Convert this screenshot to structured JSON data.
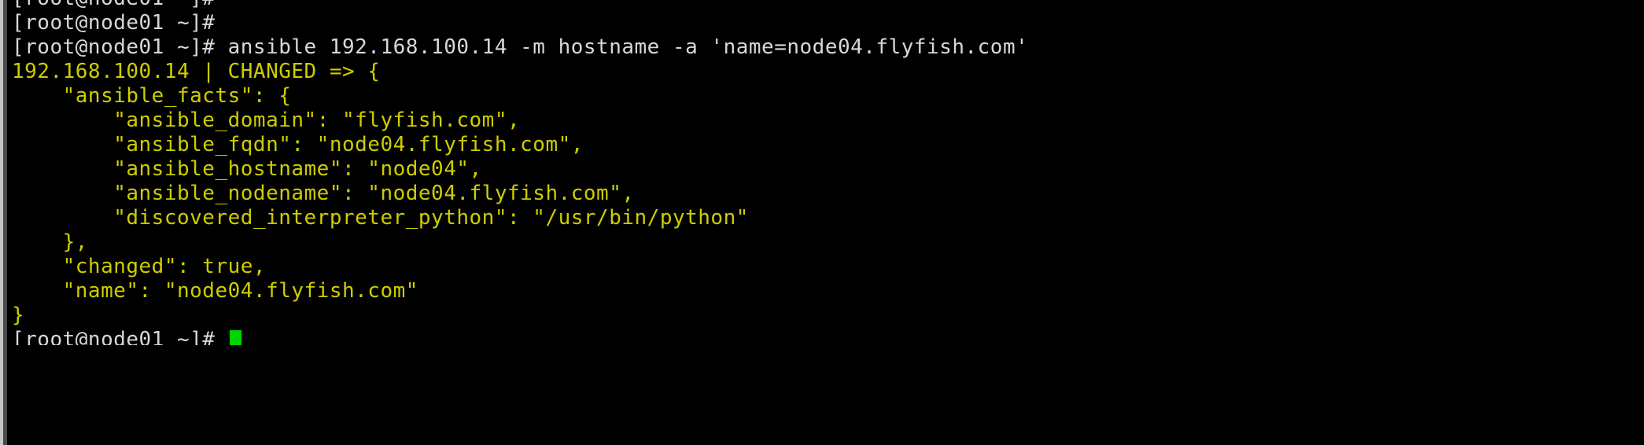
{
  "terminal": {
    "background_color": "#000000",
    "prompt_color": "#d8d8d8",
    "output_color": "#cdcd00",
    "cursor_color": "#00d400",
    "prompt": "[root@node01 ~]#",
    "cursor_glyph": "block-cursor"
  },
  "lines": [
    {
      "id": "scrollback-clipped",
      "type": "prompt",
      "color": "white",
      "text": "[root@node01 ~]#"
    },
    {
      "id": "prompt-empty",
      "type": "prompt",
      "color": "white",
      "text": "[root@node01 ~]#"
    },
    {
      "id": "command",
      "type": "command",
      "color": "white",
      "text": "[root@node01 ~]# ansible 192.168.100.14 -m hostname -a 'name=node04.flyfish.com'"
    },
    {
      "id": "result-header",
      "type": "output",
      "color": "yellow",
      "text": "192.168.100.14 | CHANGED => {"
    },
    {
      "id": "facts-open",
      "type": "output",
      "color": "yellow",
      "text": "    \"ansible_facts\": {"
    },
    {
      "id": "fact-domain",
      "type": "output",
      "color": "yellow",
      "text": "        \"ansible_domain\": \"flyfish.com\","
    },
    {
      "id": "fact-fqdn",
      "type": "output",
      "color": "yellow",
      "text": "        \"ansible_fqdn\": \"node04.flyfish.com\","
    },
    {
      "id": "fact-hostname",
      "type": "output",
      "color": "yellow",
      "text": "        \"ansible_hostname\": \"node04\","
    },
    {
      "id": "fact-nodename",
      "type": "output",
      "color": "yellow",
      "text": "        \"ansible_nodename\": \"node04.flyfish.com\","
    },
    {
      "id": "fact-interpreter",
      "type": "output",
      "color": "yellow",
      "text": "        \"discovered_interpreter_python\": \"/usr/bin/python\""
    },
    {
      "id": "facts-close",
      "type": "output",
      "color": "yellow",
      "text": "    },"
    },
    {
      "id": "changed",
      "type": "output",
      "color": "yellow",
      "text": "    \"changed\": true,"
    },
    {
      "id": "name",
      "type": "output",
      "color": "yellow",
      "text": "    \"name\": \"node04.flyfish.com\""
    },
    {
      "id": "result-close",
      "type": "output",
      "color": "yellow",
      "text": "}"
    },
    {
      "id": "prompt-final",
      "type": "prompt",
      "color": "white",
      "text": "[root@node01 ~]# "
    }
  ],
  "command_detail": {
    "program": "ansible",
    "target_host": "192.168.100.14",
    "module_flag": "-m",
    "module": "hostname",
    "args_flag": "-a",
    "args": "'name=node04.flyfish.com'"
  },
  "result_detail": {
    "host": "192.168.100.14",
    "status": "CHANGED",
    "ansible_domain": "flyfish.com",
    "ansible_fqdn": "node04.flyfish.com",
    "ansible_hostname": "node04",
    "ansible_nodename": "node04.flyfish.com",
    "discovered_interpreter_python": "/usr/bin/python",
    "changed": "true",
    "name": "node04.flyfish.com"
  }
}
